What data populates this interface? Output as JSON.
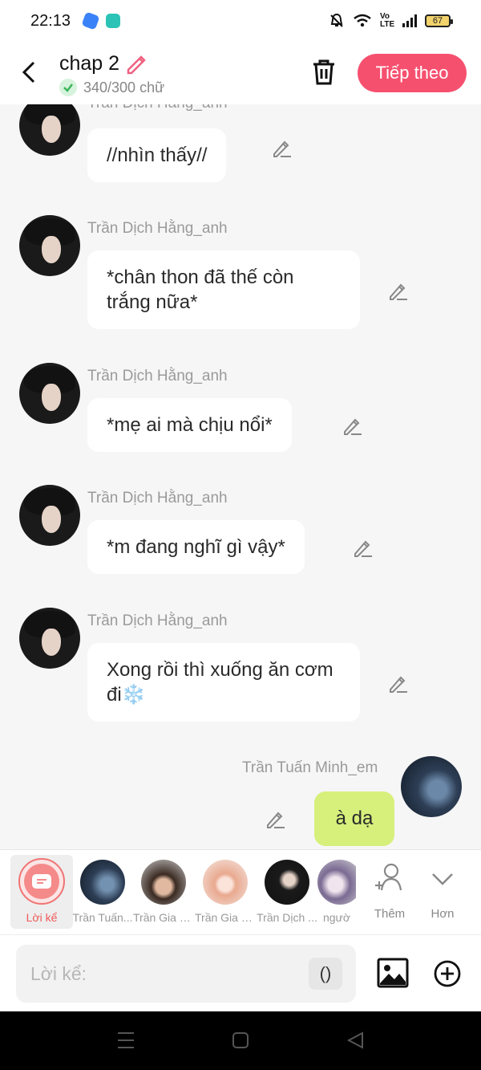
{
  "status_bar": {
    "time": "22:13",
    "network_label": "Vo LTE",
    "battery_level": "67"
  },
  "header": {
    "title": "chap 2",
    "word_count": "340/300 chữ",
    "next_button": "Tiếp theo"
  },
  "messages": [
    {
      "sender": "Trần Dịch Hằng_anh",
      "text": "//nhìn thấy//"
    },
    {
      "sender": "Trần Dịch Hằng_anh",
      "text": "*chân thon đã thế còn trắng nữa*"
    },
    {
      "sender": "Trần Dịch Hằng_anh",
      "text": "*mẹ ai mà chịu nổi*"
    },
    {
      "sender": "Trần Dịch Hằng_anh",
      "text": "*m đang nghĩ gì vậy*"
    },
    {
      "sender": "Trần Dịch Hằng_anh",
      "text": "Xong rồi thì xuống ăn cơm đi❄️"
    }
  ],
  "my_message": {
    "sender": "Trần Tuấn Minh_em",
    "text": "à dạ"
  },
  "characters": [
    {
      "label": "Lời kể"
    },
    {
      "label": "Trần Tuấn..."
    },
    {
      "label": "Trần Gia H..."
    },
    {
      "label": "Trần Gia H..."
    },
    {
      "label": "Trần Dịch ..."
    },
    {
      "label": "ngườ"
    }
  ],
  "tools": {
    "add_label": "Thêm",
    "more_label": "Hơn"
  },
  "input": {
    "placeholder": "Lời kể:",
    "paren_label": "()"
  }
}
